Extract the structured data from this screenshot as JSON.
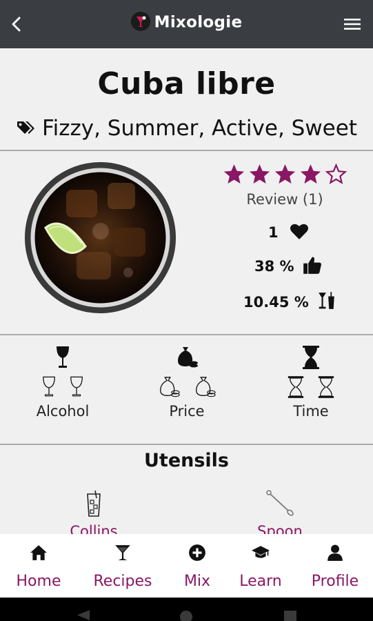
{
  "header": {
    "app_name": "Mixologie",
    "back_icon": "chevron-left-icon",
    "menu_icon": "hamburger-menu-icon"
  },
  "cocktail": {
    "name": "Cuba libre",
    "tags": "Fizzy, Summer, Active, Sweet",
    "image_icon": "cocktail-photo"
  },
  "rating": {
    "stars_filled": 4,
    "stars_total": 5,
    "review_text": "Review (1)",
    "likes": "1",
    "approval": "38 %",
    "abv": "10.45 %",
    "star_color": "#8a1764"
  },
  "specs": [
    {
      "label": "Alcohol",
      "level": 1,
      "max": 3,
      "icon": "wine-glass-icon"
    },
    {
      "label": "Price",
      "level": 1,
      "max": 3,
      "icon": "money-bag-icon"
    },
    {
      "label": "Time",
      "level": 1,
      "max": 3,
      "icon": "hourglass-icon"
    }
  ],
  "utensils": {
    "title": "Utensils",
    "items": [
      {
        "label": "Collins",
        "icon": "collins-glass-icon"
      },
      {
        "label": "Spoon",
        "icon": "bar-spoon-icon"
      }
    ]
  },
  "bottom_nav": [
    {
      "label": "Home",
      "icon": "home-icon"
    },
    {
      "label": "Recipes",
      "icon": "cocktail-icon"
    },
    {
      "label": "Mix",
      "icon": "plus-circle-icon"
    },
    {
      "label": "Learn",
      "icon": "graduation-cap-icon"
    },
    {
      "label": "Profile",
      "icon": "user-icon"
    }
  ],
  "colors": {
    "accent": "#8a1764",
    "appbar": "#3a3d42",
    "background": "#f0f0f0"
  }
}
